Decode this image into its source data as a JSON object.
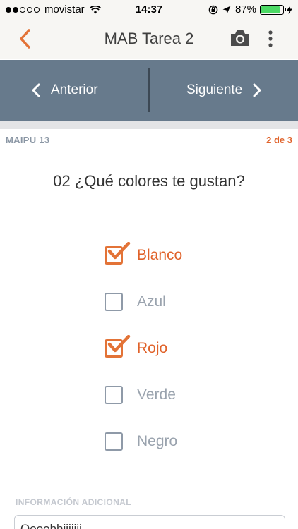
{
  "status_bar": {
    "carrier": "movistar",
    "signal_bars": 5,
    "signal_active": 2,
    "time": "14:37",
    "battery_percent": "87%",
    "battery_level": 0.87,
    "icons": [
      "wifi-icon",
      "rotation-lock-icon",
      "location-icon",
      "battery-icon",
      "charging-bolt-icon"
    ]
  },
  "nav": {
    "title": "MAB Tarea 2",
    "icons": [
      "back-chevron-icon",
      "camera-icon",
      "more-vertical-icon"
    ],
    "accent_color": "#e37337"
  },
  "pager": {
    "prev_label": "Anterior",
    "next_label": "Siguiente",
    "background_color": "#677a8c"
  },
  "header": {
    "section": "MAIPU 13",
    "counter": "2 de 3"
  },
  "question": {
    "title": "02 ¿Qué colores te gustan?",
    "options": [
      {
        "label": "Blanco",
        "checked": true
      },
      {
        "label": "Azul",
        "checked": false
      },
      {
        "label": "Rojo",
        "checked": true
      },
      {
        "label": "Verde",
        "checked": false
      },
      {
        "label": "Negro",
        "checked": false
      }
    ]
  },
  "additional": {
    "label": "INFORMACIÓN ADICIONAL",
    "value": "Oooohhiiiiiii"
  }
}
